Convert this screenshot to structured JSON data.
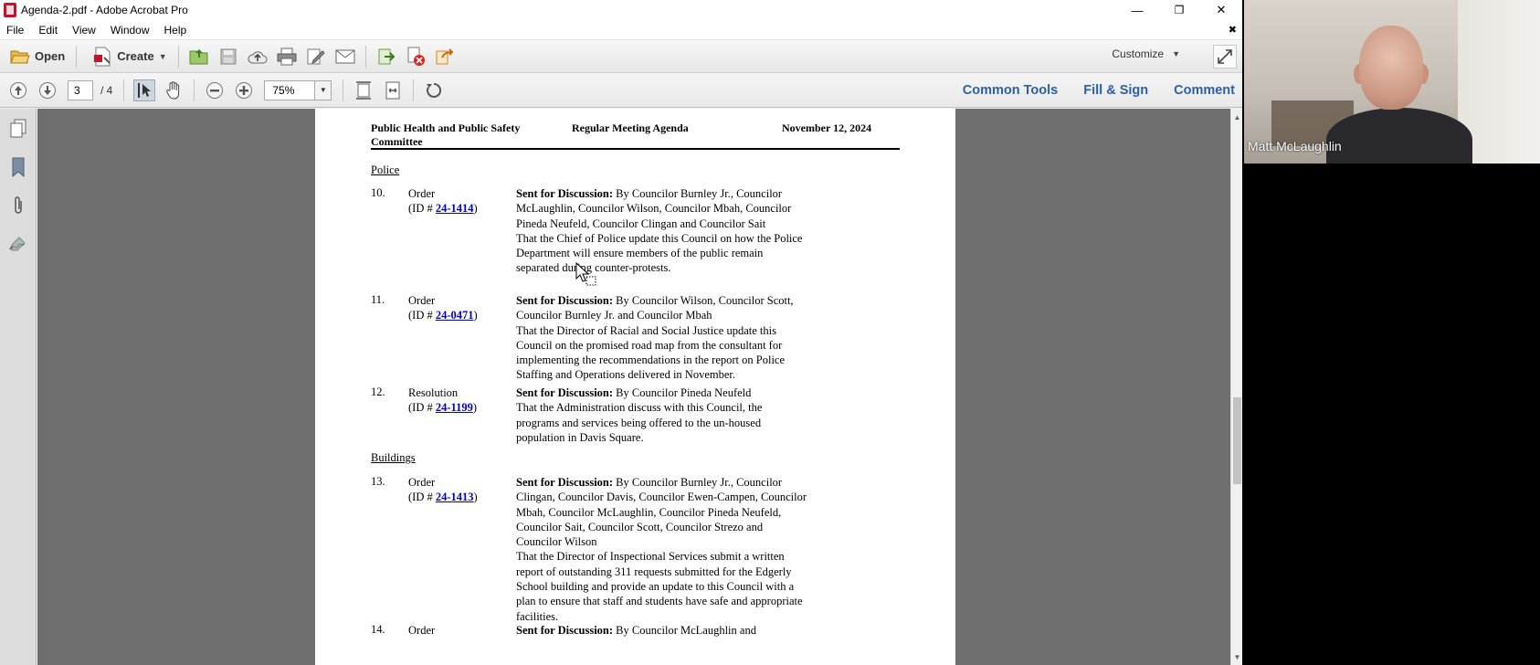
{
  "window": {
    "title": "Agenda-2.pdf - Adobe Acrobat Pro",
    "minimize": "—",
    "restore": "❐",
    "close": "✕"
  },
  "menu": {
    "items": [
      "File",
      "Edit",
      "View",
      "Window",
      "Help"
    ],
    "close_doc": "✖"
  },
  "toolbar1": {
    "open_label": "Open",
    "create_label": "Create",
    "customize_label": "Customize"
  },
  "toolbar2": {
    "current_page": "3",
    "total_pages": "/ 4",
    "zoom": "75%"
  },
  "panels": {
    "common_tools": "Common Tools",
    "fill_sign": "Fill & Sign",
    "comment": "Comment"
  },
  "document": {
    "header_left_line1": "Public Health and Public Safety",
    "header_left_line2": "Committee",
    "header_center": "Regular Meeting Agenda",
    "header_right": "November 12, 2024",
    "section_police": "Police",
    "section_buildings": "Buildings",
    "items": [
      {
        "num": "10.",
        "type": "Order",
        "id_prefix": "(ID # ",
        "id": "24-1414",
        "id_suffix": ")",
        "lead": "Sent for Discussion:",
        "sponsors": " By Councilor Burnley Jr., Councilor McLaughlin, Councilor Wilson, Councilor Mbah, Councilor Pineda Neufeld, Councilor Clingan and Councilor Sait",
        "text": "That the Chief of Police update this Council on how the Police Department will ensure members of the public remain separated during counter-protests."
      },
      {
        "num": "11.",
        "type": "Order",
        "id_prefix": "(ID # ",
        "id": "24-0471",
        "id_suffix": ")",
        "lead": "Sent for Discussion:",
        "sponsors": " By Councilor Wilson, Councilor Scott, Councilor Burnley Jr. and Councilor Mbah",
        "text": "That the Director of Racial and Social Justice update this Council on the promised road map from the consultant for implementing the recommendations in the report on Police Staffing and Operations delivered in November."
      },
      {
        "num": "12.",
        "type": "Resolution",
        "id_prefix": "(ID # ",
        "id": "24-1199",
        "id_suffix": ")",
        "lead": "Sent for Discussion:",
        "sponsors": " By Councilor Pineda Neufeld",
        "text": "That the Administration discuss with this Council, the programs and services being offered to the un-housed population in Davis Square."
      },
      {
        "num": "13.",
        "type": "Order",
        "id_prefix": "(ID # ",
        "id": "24-1413",
        "id_suffix": ")",
        "lead": "Sent for Discussion:",
        "sponsors": " By Councilor Burnley Jr., Councilor Clingan, Councilor Davis, Councilor Ewen-Campen, Councilor Mbah, Councilor McLaughlin, Councilor Pineda Neufeld, Councilor Sait, Councilor Scott, Councilor Strezo and Councilor Wilson",
        "text": "That the Director of Inspectional Services submit a written report of outstanding 311 requests submitted for the Edgerly School building and provide an update to this Council with a plan to ensure that staff and students have safe and appropriate facilities."
      },
      {
        "num": "14.",
        "type": "Order",
        "lead": "Sent for Discussion:",
        "sponsors": " By Councilor McLaughlin and"
      }
    ]
  },
  "webcam": {
    "participant_name": "Matt McLaughlin"
  },
  "colors": {
    "panel_link": "#2d5fa5",
    "doc_link": "#0000cc",
    "doc_background": "#6e6e6e"
  }
}
